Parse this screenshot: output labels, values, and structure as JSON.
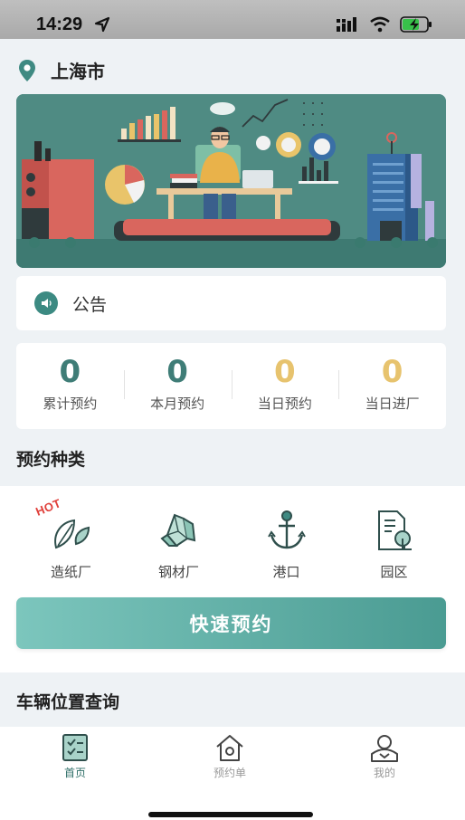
{
  "status_bar": {
    "time": "14:29"
  },
  "location": {
    "city": "上海市"
  },
  "notice": {
    "label": "公告"
  },
  "stats": [
    {
      "value": "0",
      "label": "累计预约",
      "color": "#3f7d77"
    },
    {
      "value": "0",
      "label": "本月预约",
      "color": "#3f7d77"
    },
    {
      "value": "0",
      "label": "当日预约",
      "color": "#e7c36e"
    },
    {
      "value": "0",
      "label": "当日进厂",
      "color": "#e7c36e"
    }
  ],
  "categories_section": {
    "title": "预约种类",
    "hot_badge": "HOT",
    "items": [
      {
        "label": "造纸厂",
        "icon": "leaf-icon"
      },
      {
        "label": "钢材厂",
        "icon": "crystal-icon"
      },
      {
        "label": "港口",
        "icon": "anchor-icon"
      },
      {
        "label": "园区",
        "icon": "document-tree-icon"
      }
    ]
  },
  "quick_booking": {
    "label": "快速预约"
  },
  "vehicle_section": {
    "title": "车辆位置查询"
  },
  "tabbar": {
    "items": [
      {
        "label": "首页",
        "active": true
      },
      {
        "label": "预约单",
        "active": false
      },
      {
        "label": "我的",
        "active": false
      }
    ]
  },
  "colors": {
    "accent": "#3f8a82",
    "highlight": "#e7c36e",
    "active_tab": "#2f6f68",
    "inactive_tab": "#999999"
  }
}
